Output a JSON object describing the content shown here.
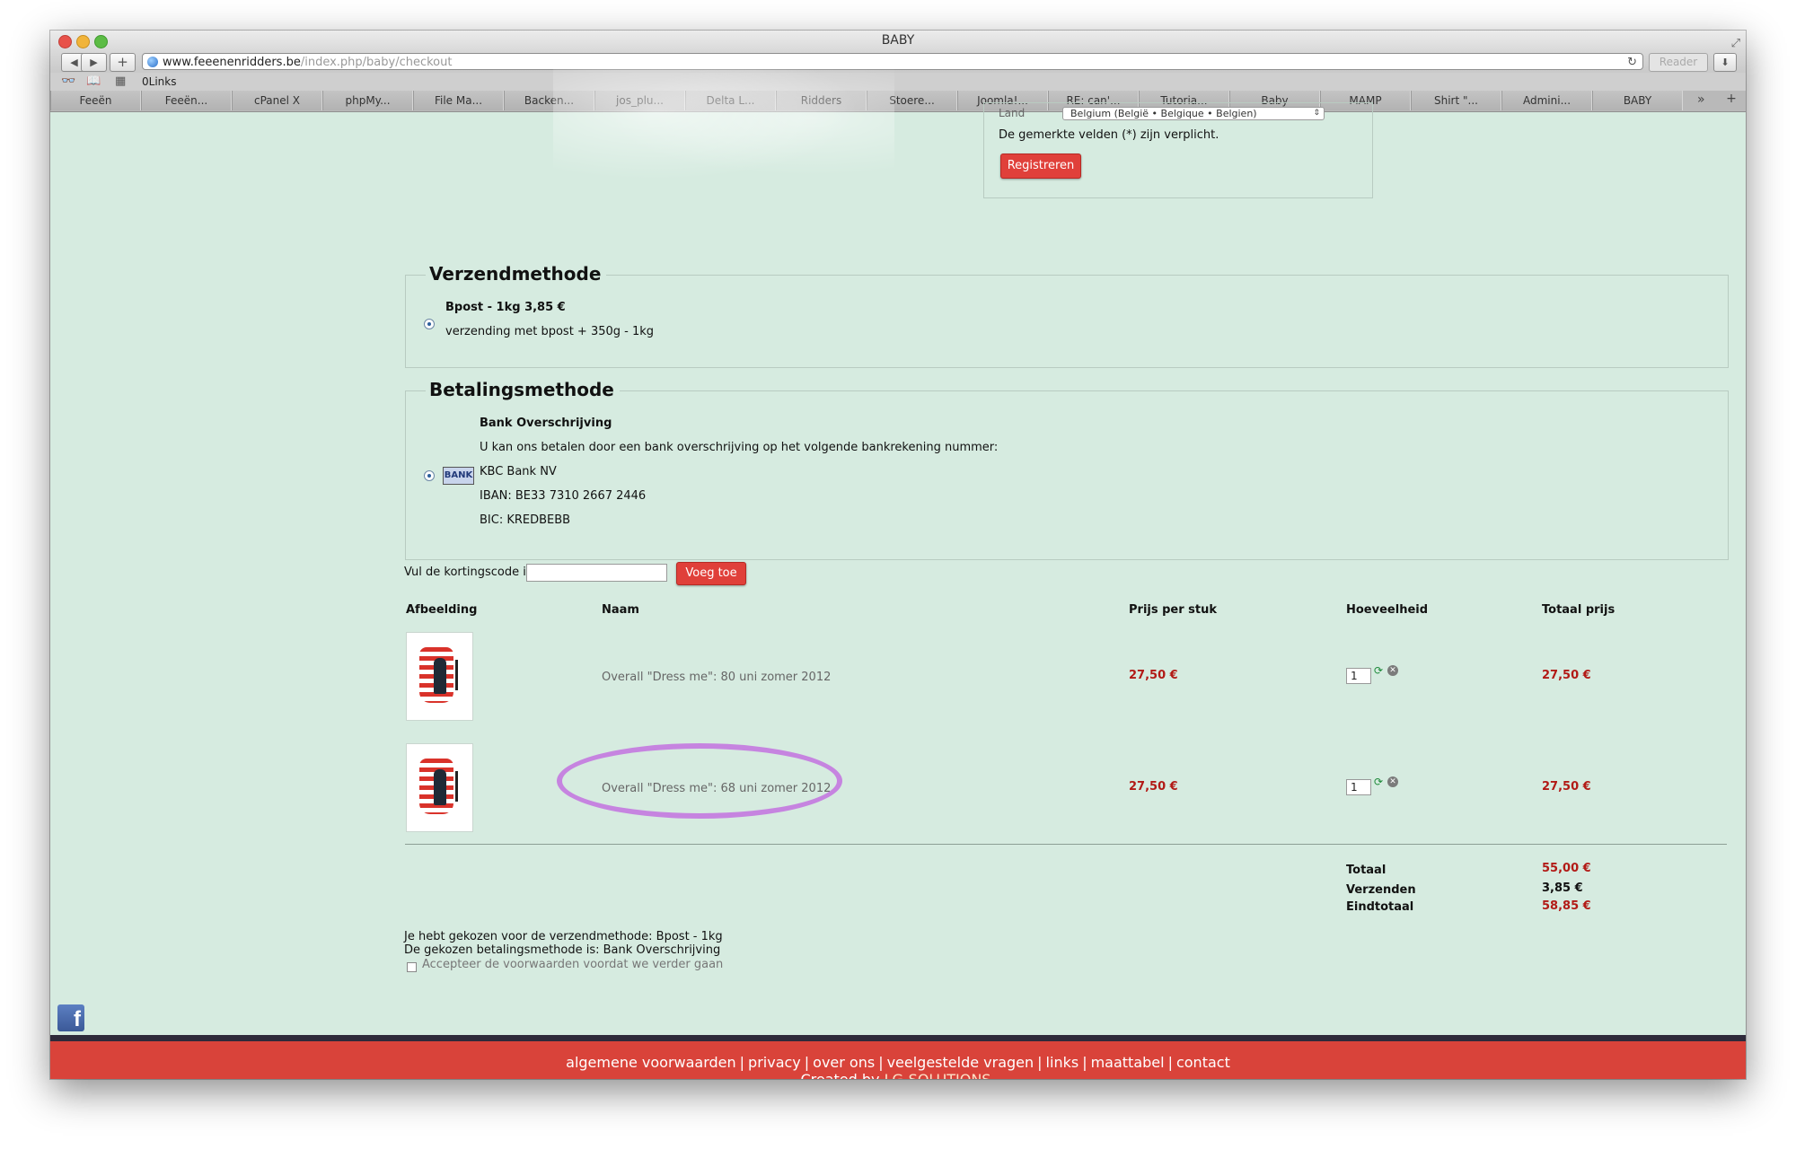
{
  "browser": {
    "window_title": "BABY",
    "url_host": "www.feeenenridders.be",
    "url_path": "/index.php/baby/checkout",
    "reader_label": "Reader",
    "bookmarks_label": "0Links",
    "tabs": [
      "Feeën",
      "Feeën...",
      "cPanel X",
      "phpMy...",
      "File Ma...",
      "Backen...",
      "jos_plu...",
      "Delta L...",
      "Ridders",
      "Stoere...",
      "Joomla!...",
      "RE: can'...",
      "Tutoria...",
      "Baby",
      "MAMP",
      "Shirt \"...",
      "Admini...",
      "BABY"
    ]
  },
  "registration": {
    "land_label": "Land",
    "land_value": "Belgium (België • Belgique • Belgien)",
    "required_note": "De gemerkte velden (*) zijn verplicht.",
    "register_button": "Registreren"
  },
  "shipping": {
    "title": "Verzendmethode",
    "option_name": "Bpost - 1kg 3,85 €",
    "option_desc": "verzending met bpost + 350g - 1kg"
  },
  "payment": {
    "title": "Betalingsmethode",
    "bank_logo_text": "BANK",
    "option_name": "Bank Overschrijving",
    "line1": "U kan ons betalen door een bank overschrijving op het volgende bankrekening nummer:",
    "line2": "KBC Bank NV",
    "line3": "IBAN: BE33 7310 2667 2446",
    "line4": "BIC: KREDBEBB"
  },
  "coupon": {
    "label": "Vul de kortingscode in",
    "value": "",
    "button": "Voeg toe"
  },
  "cart": {
    "headers": {
      "image": "Afbeelding",
      "name": "Naam",
      "unit_price": "Prijs per stuk",
      "quantity": "Hoeveelheid",
      "total": "Totaal prijs"
    },
    "items": [
      {
        "name": "Overall \"Dress me\": 80 uni zomer 2012",
        "unit_price": "27,50 €",
        "quantity": "1",
        "total": "27,50 €"
      },
      {
        "name": "Overall \"Dress me\": 68 uni zomer 2012",
        "unit_price": "27,50 €",
        "quantity": "1",
        "total": "27,50 €"
      }
    ]
  },
  "summary": {
    "total_label": "Totaal",
    "total_value": "55,00 €",
    "shipping_label": "Verzenden",
    "shipping_value": "3,85 €",
    "grand_label": "Eindtotaal",
    "grand_value": "58,85 €"
  },
  "confirmation": {
    "shipping_chosen": "Je hebt gekozen voor de verzendmethode: Bpost - 1kg",
    "payment_chosen": "De gekozen betalingsmethode is: Bank Overschrijving",
    "terms_label": "Accepteer de voorwaarden voordat we verder gaan"
  },
  "footer": {
    "links": [
      "algemene voorwaarden",
      "privacy",
      "over ons",
      "veelgestelde vragen",
      "links",
      "maattabel",
      "contact"
    ],
    "credit_prefix": "Created by ",
    "credit_link": "LG-SOLUTIONS",
    "credit_suffix": "."
  },
  "colors": {
    "page_background": "#d6ebe0",
    "accent_red": "#e0403a",
    "price_red": "#b21a16",
    "footer_red": "#d9433a",
    "annotation_purple": "#c684e0"
  }
}
